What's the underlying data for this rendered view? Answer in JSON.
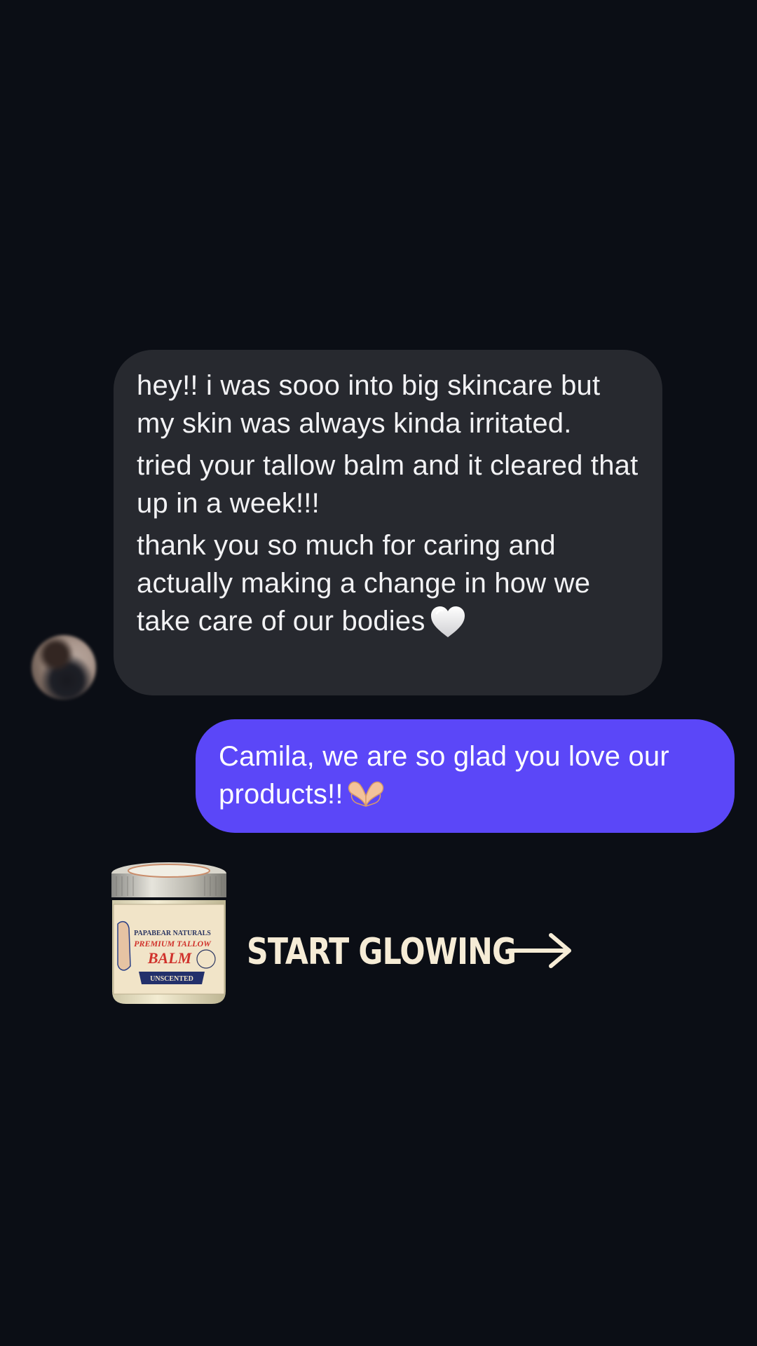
{
  "incoming_message": {
    "paragraphs": [
      "hey!! i was sooo into big skincare but my skin was always kinda irritated.",
      "tried your tallow balm and it cleared that up in a week!!!",
      "thank you so much for caring and actually making a change in how we take care of our bodies"
    ],
    "emoji": "white-heart",
    "bubble_color": "#27292f"
  },
  "outgoing_message": {
    "text": "Camila, we are so glad you love our products!!",
    "emoji": "heart-hands",
    "bubble_color": "#5b47f8"
  },
  "product": {
    "brand": "PAPABEAR NATURALS",
    "line": "PREMIUM TALLOW",
    "name": "BALM",
    "variant": "UNSCENTED"
  },
  "cta": {
    "label": "START GLOWING",
    "icon": "arrow-right-icon",
    "color": "#f6ecd6"
  },
  "theme": {
    "background": "#0b0e15"
  }
}
